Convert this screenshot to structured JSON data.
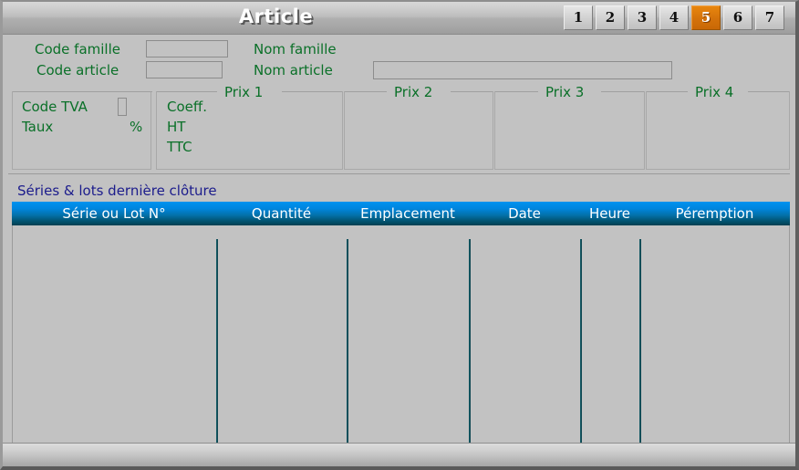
{
  "window": {
    "title": "Article"
  },
  "nav": {
    "buttons": [
      {
        "label": "1",
        "active": false
      },
      {
        "label": "2",
        "active": false
      },
      {
        "label": "3",
        "active": false
      },
      {
        "label": "4",
        "active": false
      },
      {
        "label": "5",
        "active": true
      },
      {
        "label": "6",
        "active": false
      },
      {
        "label": "7",
        "active": false
      }
    ],
    "active_index": 5
  },
  "form": {
    "code_famille_label": "Code famille",
    "code_famille_value": "",
    "nom_famille_label": "Nom famille",
    "nom_famille_value": "",
    "code_article_label": "Code article",
    "code_article_value": "",
    "nom_article_label": "Nom article",
    "nom_article_value": ""
  },
  "tva": {
    "code_tva_label": "Code TVA",
    "code_tva_value": "",
    "taux_label": "Taux",
    "taux_value": "",
    "percent_symbol": "%"
  },
  "prix_groups": [
    {
      "title": "Prix 1",
      "rows": [
        {
          "label": "Coeff.",
          "value": ""
        },
        {
          "label": "HT",
          "value": ""
        },
        {
          "label": "TTC",
          "value": ""
        }
      ]
    },
    {
      "title": "Prix 2",
      "rows": []
    },
    {
      "title": "Prix 3",
      "rows": []
    },
    {
      "title": "Prix 4",
      "rows": []
    }
  ],
  "series_section": {
    "caption": "Séries & lots dernière clôture"
  },
  "grid": {
    "columns": [
      "Série ou Lot N°",
      "Quantité",
      "Emplacement",
      "Date",
      "Heure",
      "Péremption"
    ],
    "rows": []
  },
  "colors": {
    "label_green": "#0a7028",
    "caption_blue": "#1c1c8c",
    "accent_orange": "#d4720a",
    "grid_header_blue": "#0092ef",
    "grid_header_dark": "#013f51",
    "window_gray": "#c2c2c2"
  }
}
